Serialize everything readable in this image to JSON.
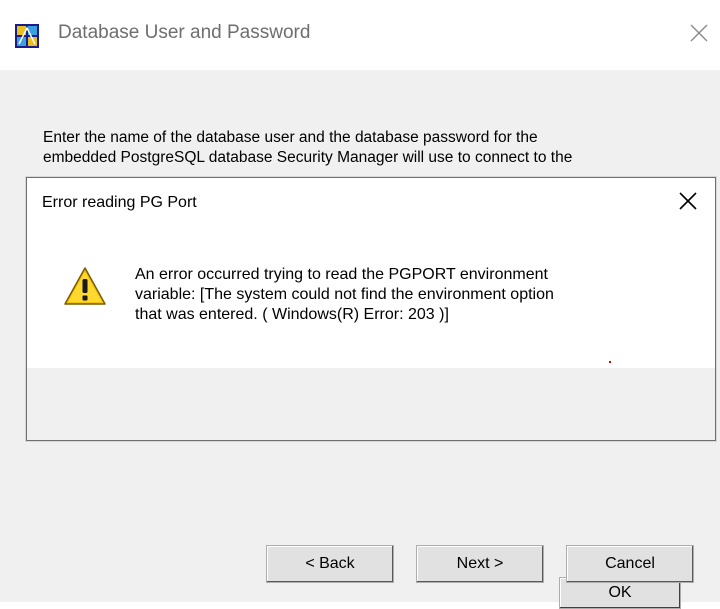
{
  "window": {
    "title": "Database User and Password"
  },
  "intro": {
    "line1": "Enter the name of the database user and the database password for the",
    "line2": "embedded PostgreSQL database Security Manager will use to connect to the"
  },
  "error_dialog": {
    "title": "Error reading PG Port",
    "message_lines": [
      "An error occurred trying to read the PGPORT environment",
      "variable: [The system could not find the environment option",
      "that was entered.  ( Windows(R) Error: 203 )]"
    ],
    "ok_label": "OK",
    "icon": "warning-icon"
  },
  "wizard_buttons": {
    "back_label": "< Back",
    "next_label": "Next >",
    "cancel_label": "Cancel"
  },
  "colors": {
    "dialog_face": "#f0f0f0",
    "warning_yellow": "#f5c400",
    "title_text": "#6e6e6e"
  }
}
